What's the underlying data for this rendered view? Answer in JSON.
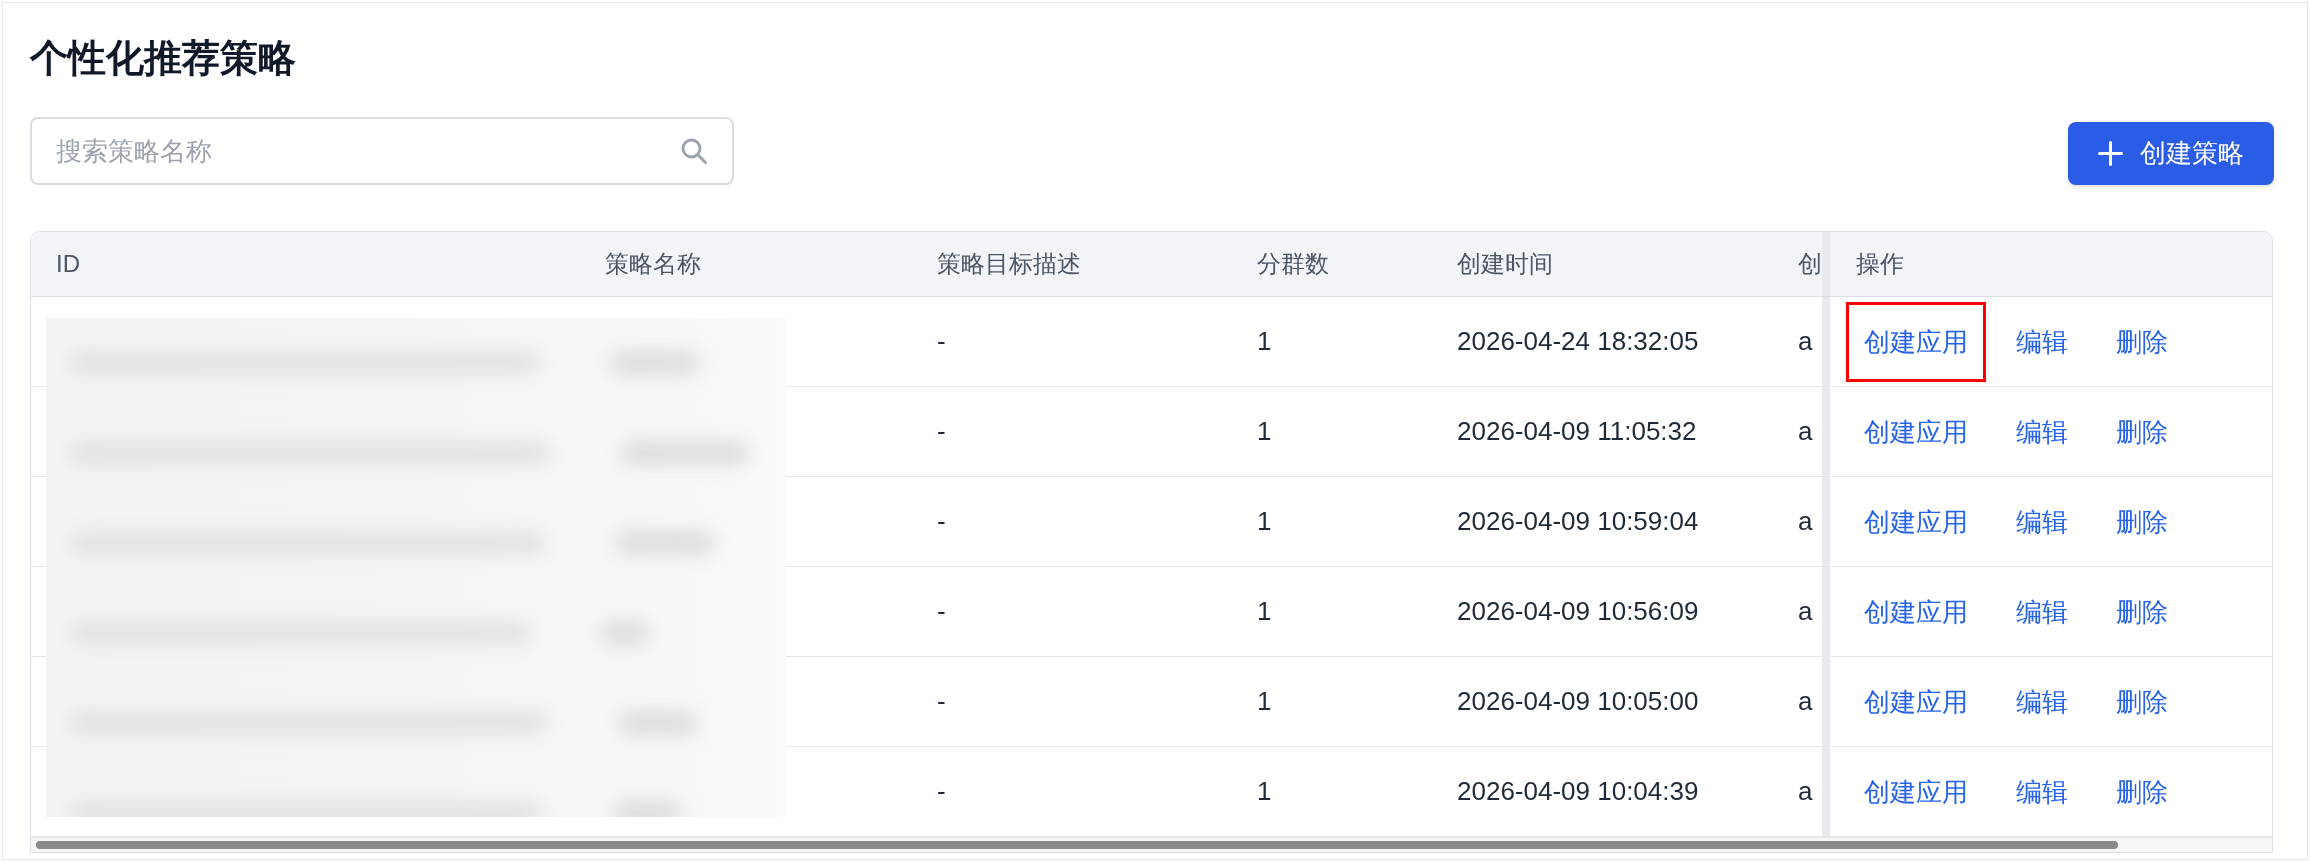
{
  "page": {
    "title": "个性化推荐策略"
  },
  "toolbar": {
    "search": {
      "placeholder": "搜索策略名称"
    },
    "create_button": {
      "label": "创建策略"
    }
  },
  "table": {
    "columns": [
      "ID",
      "策略名称",
      "策略目标描述",
      "分群数",
      "创建时间",
      "创",
      "操作"
    ],
    "rows": [
      {
        "description": "-",
        "segment_count": "1",
        "created_at": "2026-04-24 18:32:05",
        "column_6": "a",
        "actions": [
          {
            "label": "创建应用",
            "highlighted": true
          },
          {
            "label": "编辑",
            "highlighted": false
          },
          {
            "label": "删除",
            "highlighted": false
          }
        ]
      },
      {
        "description": "-",
        "segment_count": "1",
        "created_at": "2026-04-09 11:05:32",
        "column_6": "a",
        "actions": [
          {
            "label": "创建应用",
            "highlighted": false
          },
          {
            "label": "编辑",
            "highlighted": false
          },
          {
            "label": "删除",
            "highlighted": false
          }
        ]
      },
      {
        "description": "-",
        "segment_count": "1",
        "created_at": "2026-04-09 10:59:04",
        "column_6": "a",
        "actions": [
          {
            "label": "创建应用",
            "highlighted": false
          },
          {
            "label": "编辑",
            "highlighted": false
          },
          {
            "label": "删除",
            "highlighted": false
          }
        ]
      },
      {
        "description": "-",
        "segment_count": "1",
        "created_at": "2026-04-09 10:56:09",
        "column_6": "a",
        "actions": [
          {
            "label": "创建应用",
            "highlighted": false
          },
          {
            "label": "编辑",
            "highlighted": false
          },
          {
            "label": "删除",
            "highlighted": false
          }
        ]
      },
      {
        "description": "-",
        "segment_count": "1",
        "created_at": "2026-04-09 10:05:00",
        "column_6": "a",
        "actions": [
          {
            "label": "创建应用",
            "highlighted": false
          },
          {
            "label": "编辑",
            "highlighted": false
          },
          {
            "label": "删除",
            "highlighted": false
          }
        ]
      },
      {
        "description": "-",
        "segment_count": "1",
        "created_at": "2026-04-09 10:04:39",
        "column_6": "a",
        "actions": [
          {
            "label": "创建应用",
            "highlighted": false
          },
          {
            "label": "编辑",
            "highlighted": false
          },
          {
            "label": "删除",
            "highlighted": false
          }
        ]
      }
    ]
  }
}
